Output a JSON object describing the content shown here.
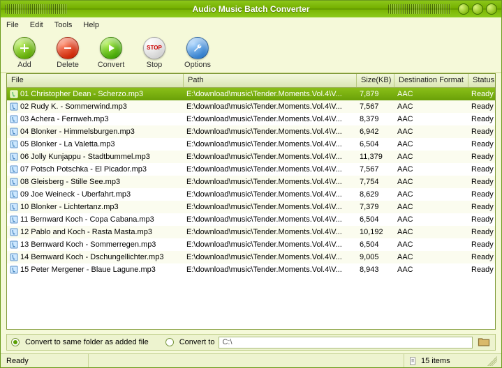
{
  "title": "Audio Music Batch Converter",
  "menu": [
    "File",
    "Edit",
    "Tools",
    "Help"
  ],
  "toolbar": {
    "add": "Add",
    "delete": "Delete",
    "convert": "Convert",
    "stop": "Stop",
    "stop_icon_text": "STOP",
    "options": "Options"
  },
  "columns": {
    "file": "File",
    "path": "Path",
    "size": "Size(KB)",
    "fmt": "Destination Format",
    "status": "Status"
  },
  "rows": [
    {
      "file": "01 Christopher Dean - Scherzo.mp3",
      "path": "E:\\download\\music\\Tender.Moments.Vol.4\\V...",
      "size": "7,879",
      "fmt": "AAC",
      "status": "Ready",
      "selected": true
    },
    {
      "file": "02 Rudy K. - Sommerwind.mp3",
      "path": "E:\\download\\music\\Tender.Moments.Vol.4\\V...",
      "size": "7,567",
      "fmt": "AAC",
      "status": "Ready"
    },
    {
      "file": "03 Achera - Fernweh.mp3",
      "path": "E:\\download\\music\\Tender.Moments.Vol.4\\V...",
      "size": "8,379",
      "fmt": "AAC",
      "status": "Ready"
    },
    {
      "file": "04 Blonker - Himmelsburgen.mp3",
      "path": "E:\\download\\music\\Tender.Moments.Vol.4\\V...",
      "size": "6,942",
      "fmt": "AAC",
      "status": "Ready"
    },
    {
      "file": "05 Blonker - La Valetta.mp3",
      "path": "E:\\download\\music\\Tender.Moments.Vol.4\\V...",
      "size": "6,504",
      "fmt": "AAC",
      "status": "Ready"
    },
    {
      "file": "06 Jolly Kunjappu - Stadtbummel.mp3",
      "path": "E:\\download\\music\\Tender.Moments.Vol.4\\V...",
      "size": "11,379",
      "fmt": "AAC",
      "status": "Ready"
    },
    {
      "file": "07 Potsch Potschka - El Picador.mp3",
      "path": "E:\\download\\music\\Tender.Moments.Vol.4\\V...",
      "size": "7,567",
      "fmt": "AAC",
      "status": "Ready"
    },
    {
      "file": "08 Gleisberg - Stille See.mp3",
      "path": "E:\\download\\music\\Tender.Moments.Vol.4\\V...",
      "size": "7,754",
      "fmt": "AAC",
      "status": "Ready"
    },
    {
      "file": "09 Joe Weineck - Uberfahrt.mp3",
      "path": "E:\\download\\music\\Tender.Moments.Vol.4\\V...",
      "size": "8,629",
      "fmt": "AAC",
      "status": "Ready"
    },
    {
      "file": "10 Blonker - Lichtertanz.mp3",
      "path": "E:\\download\\music\\Tender.Moments.Vol.4\\V...",
      "size": "7,379",
      "fmt": "AAC",
      "status": "Ready"
    },
    {
      "file": "11 Bernward Koch - Copa Cabana.mp3",
      "path": "E:\\download\\music\\Tender.Moments.Vol.4\\V...",
      "size": "6,504",
      "fmt": "AAC",
      "status": "Ready"
    },
    {
      "file": "12 Pablo and Koch - Rasta Masta.mp3",
      "path": "E:\\download\\music\\Tender.Moments.Vol.4\\V...",
      "size": "10,192",
      "fmt": "AAC",
      "status": "Ready"
    },
    {
      "file": "13 Bernward Koch - Sommerregen.mp3",
      "path": "E:\\download\\music\\Tender.Moments.Vol.4\\V...",
      "size": "6,504",
      "fmt": "AAC",
      "status": "Ready"
    },
    {
      "file": "14 Bernward Koch - Dschungellichter.mp3",
      "path": "E:\\download\\music\\Tender.Moments.Vol.4\\V...",
      "size": "9,005",
      "fmt": "AAC",
      "status": "Ready"
    },
    {
      "file": "15 Peter Mergener - Blaue Lagune.mp3",
      "path": "E:\\download\\music\\Tender.Moments.Vol.4\\V...",
      "size": "8,943",
      "fmt": "AAC",
      "status": "Ready"
    }
  ],
  "dest": {
    "same_label": "Convert to same folder as added file",
    "to_label": "Convert to",
    "path": "C:\\"
  },
  "status": {
    "ready": "Ready",
    "items": "15 items"
  }
}
